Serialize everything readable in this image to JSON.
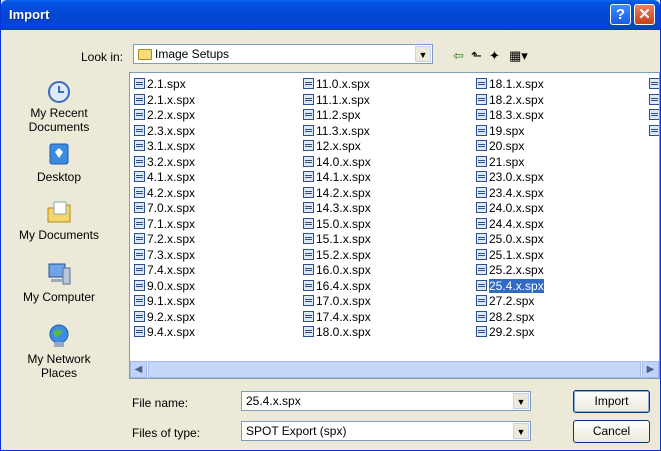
{
  "window": {
    "title": "Import"
  },
  "lookin": {
    "label": "Look in:",
    "value": "Image Setups"
  },
  "places": [
    {
      "label": "My Recent\nDocuments"
    },
    {
      "label": "Desktop"
    },
    {
      "label": "My Documents"
    },
    {
      "label": "My Computer"
    },
    {
      "label": "My Network\nPlaces"
    }
  ],
  "files": {
    "col1": [
      "2.1.spx",
      "2.1.x.spx",
      "2.2.x.spx",
      "2.3.x.spx",
      "3.1.x.spx",
      "3.2.x.spx",
      "4.1.x.spx",
      "4.2.x.spx",
      "7.0.x.spx",
      "7.1.x.spx",
      "7.2.x.spx",
      "7.3.x.spx",
      "7.4.x.spx",
      "9.0.x.spx",
      "9.1.x.spx",
      "9.2.x.spx",
      "9.4.x.spx"
    ],
    "col2": [
      "11.0.x.spx",
      "11.1.x.spx",
      "11.2.spx",
      "11.3.x.spx",
      "12.x.spx",
      "14.0.x.spx",
      "14.1.x.spx",
      "14.2.x.spx",
      "14.3.x.spx",
      "15.0.x.spx",
      "15.1.x.spx",
      "15.2.x.spx",
      "16.0.x.spx",
      "16.4.x.spx",
      "17.0.x.spx",
      "17.4.x.spx",
      "18.0.x.spx"
    ],
    "col3": [
      "18.1.x.spx",
      "18.2.x.spx",
      "18.3.x.spx",
      "19.spx",
      "20.spx",
      "21.spx",
      "23.0.x.spx",
      "23.4.x.spx",
      "24.0.x.spx",
      "24.4.x.spx",
      "25.0.x.spx",
      "25.1.x.spx",
      "25.2.x.spx",
      "25.4.x.spx",
      "27.2.spx",
      "28.2.spx",
      "29.2.spx"
    ],
    "selected": "25.4.x.spx"
  },
  "filename": {
    "label": "File name:",
    "value": "25.4.x.spx"
  },
  "filetype": {
    "label": "Files of type:",
    "value": "SPOT Export (spx)"
  },
  "buttons": {
    "import": "Import",
    "cancel": "Cancel"
  },
  "colors": {
    "title_blue": "#0249d6",
    "selection": "#316ac5",
    "dialog_bg": "#ece9d8"
  }
}
